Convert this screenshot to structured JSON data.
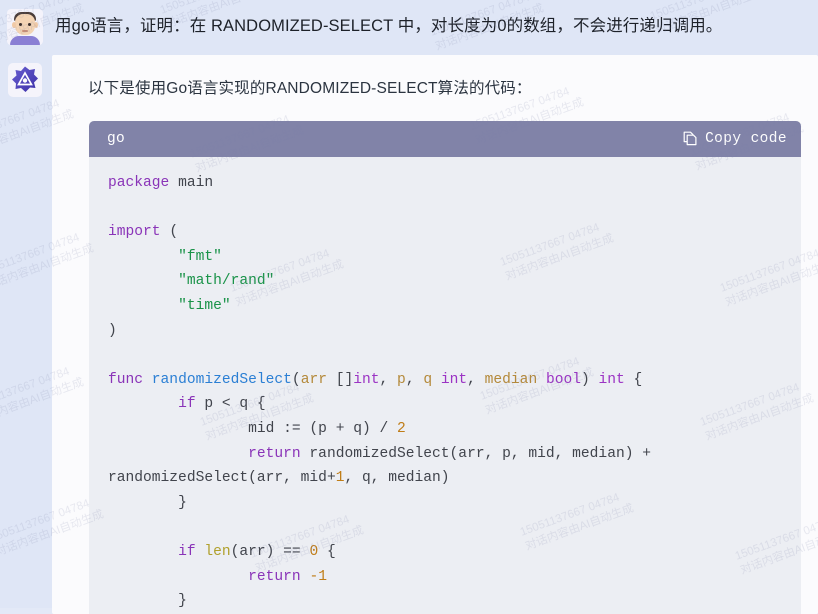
{
  "conversation": {
    "user": {
      "avatar_icon": "user-avatar-icon",
      "message": "用go语言，证明：在 RANDOMIZED-SELECT 中，对长度为0的数组，不会进行递归调用。"
    },
    "assistant": {
      "avatar_icon": "assistant-logo-icon",
      "intro": "以下是使用Go语言实现的RANDOMIZED-SELECT算法的代码：",
      "code_block": {
        "language": "go",
        "copy_label": "Copy code",
        "copy_icon": "copy-pages-icon",
        "lines": [
          "package main",
          "",
          "import (",
          "        \"fmt\"",
          "        \"math/rand\"",
          "        \"time\"",
          ")",
          "",
          "func randomizedSelect(arr []int, p, q int, median bool) int {",
          "    if p < q {",
          "        mid := (p + q) / 2",
          "        return randomizedSelect(arr, p, mid, median) + randomizedSelect(arr, mid+1, q, median)",
          "    }",
          "",
          "    if len(arr) == 0 {",
          "        return -1",
          "    }"
        ]
      }
    }
  },
  "watermark": {
    "line1": "15051137667 04784",
    "line2": "对话内容由AI自动生成"
  },
  "colors": {
    "page_background": "#dfe6f6",
    "bubble_background": "#fbfbfd",
    "code_header": "#8183a8",
    "code_body": "#eceef3",
    "keyword": "#8a34b8",
    "string": "#1a9349",
    "number": "#c07d18",
    "function": "#2b7fd4"
  }
}
